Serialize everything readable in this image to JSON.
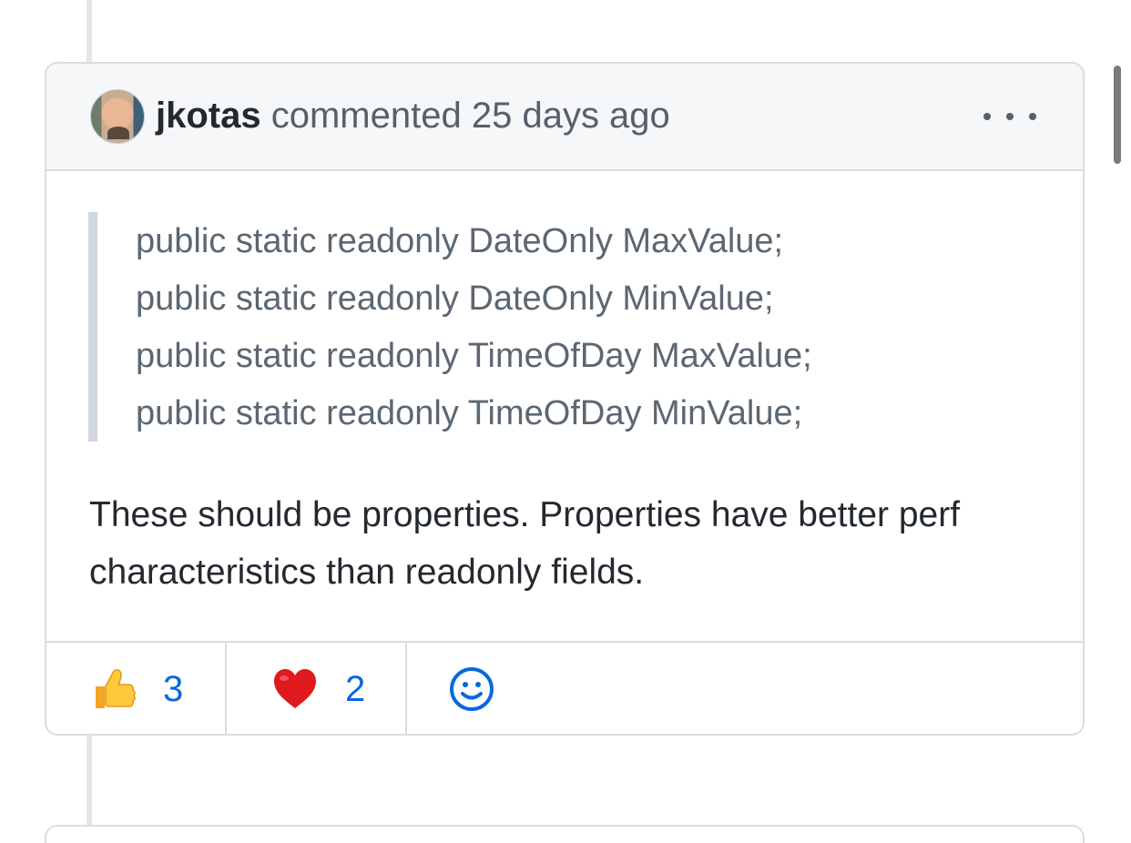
{
  "comment": {
    "author": "jkotas",
    "action": "commented",
    "time": "25 days ago",
    "more_icon": "kebab-horizontal-icon",
    "quote_lines": [
      "public static readonly DateOnly MaxValue;",
      "public static readonly DateOnly MinValue;",
      "public static readonly TimeOfDay MaxValue;",
      "public static readonly TimeOfDay MinValue;"
    ],
    "body": "These should be properties. Properties have better perf characteristics than readonly fields."
  },
  "reactions": [
    {
      "icon": "thumbs-up-icon",
      "count": "3"
    },
    {
      "icon": "heart-icon",
      "count": "2"
    }
  ],
  "add_reaction_icon": "smiley-icon",
  "colors": {
    "link": "#0969da",
    "header_bg": "#f5f7f9",
    "border": "#d8dde3",
    "quote_text": "#5c6772"
  }
}
